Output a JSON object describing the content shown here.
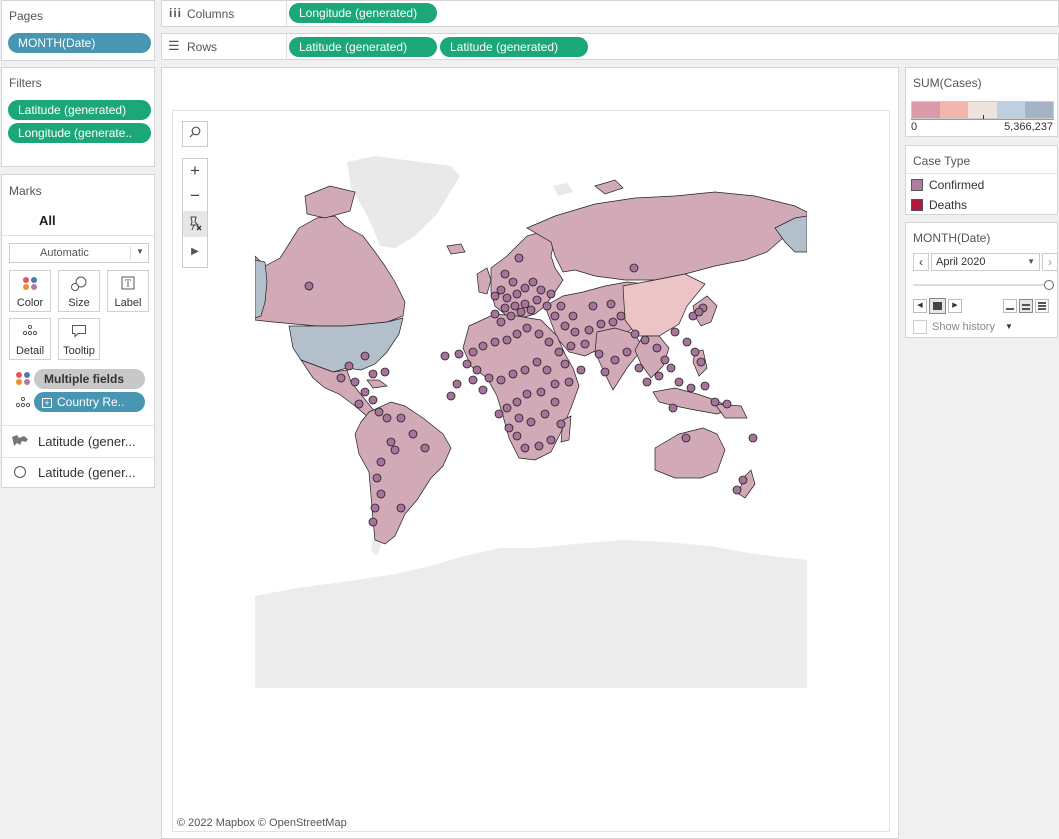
{
  "shelves": {
    "pages_title": "Pages",
    "pages_pill": "MONTH(Date)",
    "columns_label": "Columns",
    "columns_pill": "Longitude (generated)",
    "rows_label": "Rows",
    "rows_pill_1": "Latitude (generated)",
    "rows_pill_2": "Latitude (generated)"
  },
  "filters": {
    "title": "Filters",
    "items": [
      "Latitude (generated)",
      "Longitude (generate.."
    ]
  },
  "marks": {
    "title": "Marks",
    "all_label": "All",
    "mark_type": "Automatic",
    "cards": [
      "Color",
      "Size",
      "Label",
      "Detail",
      "Tooltip"
    ],
    "color_field": "Multiple fields",
    "detail_field": "Country Re..",
    "layers": [
      "Latitude (gener...",
      "Latitude (gener..."
    ]
  },
  "legend_sum": {
    "title": "SUM(Cases)",
    "min": "0",
    "max": "5,366,237",
    "colors": [
      "#dc9aa8",
      "#f3b5ad",
      "#efe4dd",
      "#bdd0e2",
      "#a4b3c6"
    ]
  },
  "legend_case": {
    "title": "Case Type",
    "items": [
      {
        "label": "Confirmed",
        "color": "#b07c9e"
      },
      {
        "label": "Deaths",
        "color": "#b5173a"
      }
    ]
  },
  "page_control": {
    "title": "MONTH(Date)",
    "value": "April 2020",
    "show_history": "Show history"
  },
  "map": {
    "attribution": "© 2022 Mapbox © OpenStreetMap",
    "land_color": "#d2a9b6",
    "usa_color": "#b3bfcb",
    "dot_color": "#a8739a"
  }
}
